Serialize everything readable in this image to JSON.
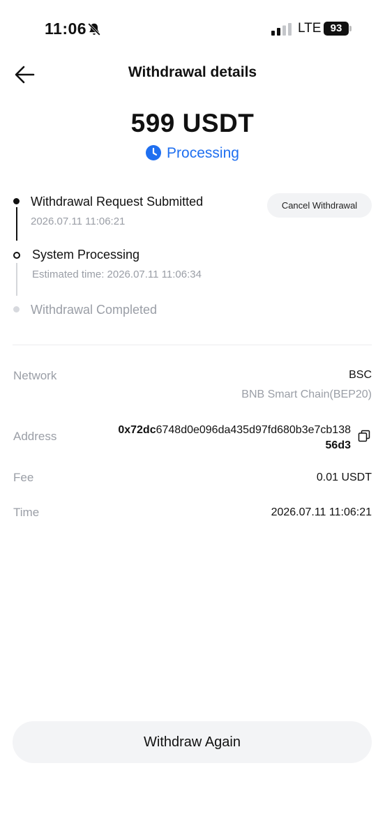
{
  "status_bar": {
    "time": "11:06",
    "network": "LTE",
    "battery": "93"
  },
  "header": {
    "title": "Withdrawal details"
  },
  "summary": {
    "amount": "599 USDT",
    "status": "Processing",
    "status_color": "#1f6ff0"
  },
  "timeline": [
    {
      "label": "Withdrawal Request Submitted",
      "time": "2026.07.11 11:06:21",
      "state": "done"
    },
    {
      "label": "System Processing",
      "time": "Estimated time: 2026.07.11 11:06:34",
      "state": "current"
    },
    {
      "label": "Withdrawal Completed",
      "time": "",
      "state": "pending"
    }
  ],
  "actions": {
    "cancel_label": "Cancel Withdrawal",
    "withdraw_again_label": "Withdraw Again"
  },
  "details": {
    "network_label": "Network",
    "network_value": "BSC",
    "network_sub": "BNB Smart Chain(BEP20)",
    "address_label": "Address",
    "address_prefix": "0x72dc",
    "address_rest": "6748d0e096da435d97fd680b3e7cb138",
    "address_tail": "56d3",
    "fee_label": "Fee",
    "fee_value": "0.01 USDT",
    "time_label": "Time",
    "time_value": "2026.07.11 11:06:21"
  },
  "icons": {
    "back": "arrow-left-icon",
    "status": "clock-icon",
    "copy": "copy-icon",
    "bell": "bell-muted-icon"
  }
}
